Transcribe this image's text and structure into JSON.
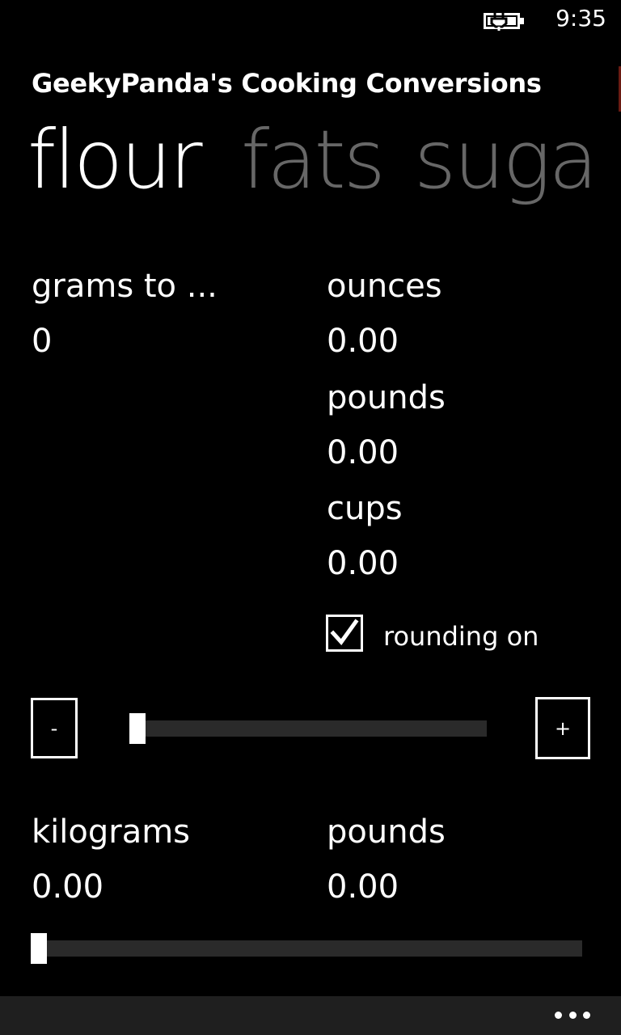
{
  "status_bar": {
    "time": "9:35",
    "battery_icon": "battery-charging-icon"
  },
  "app": {
    "title": "GeekyPanda's Cooking Conversions"
  },
  "pivot": {
    "items": [
      "flour",
      "fats",
      "suga"
    ]
  },
  "grams_section": {
    "input_label": "grams to ...",
    "input_value": "0",
    "outputs": [
      {
        "label": "ounces",
        "value": "0.00"
      },
      {
        "label": "pounds",
        "value": "0.00"
      },
      {
        "label": "cups",
        "value": "0.00"
      }
    ],
    "rounding_label": "rounding on",
    "rounding_checked": true,
    "minus_label": "-",
    "plus_label": "+",
    "slider_value_fraction": 0.0
  },
  "kg_section": {
    "kilograms_label": "kilograms",
    "kilograms_value": "0.00",
    "pounds_label": "pounds",
    "pounds_value": "0.00",
    "slider_value_fraction": 0.0
  },
  "app_bar": {
    "more_icon": "more-dots-icon"
  }
}
